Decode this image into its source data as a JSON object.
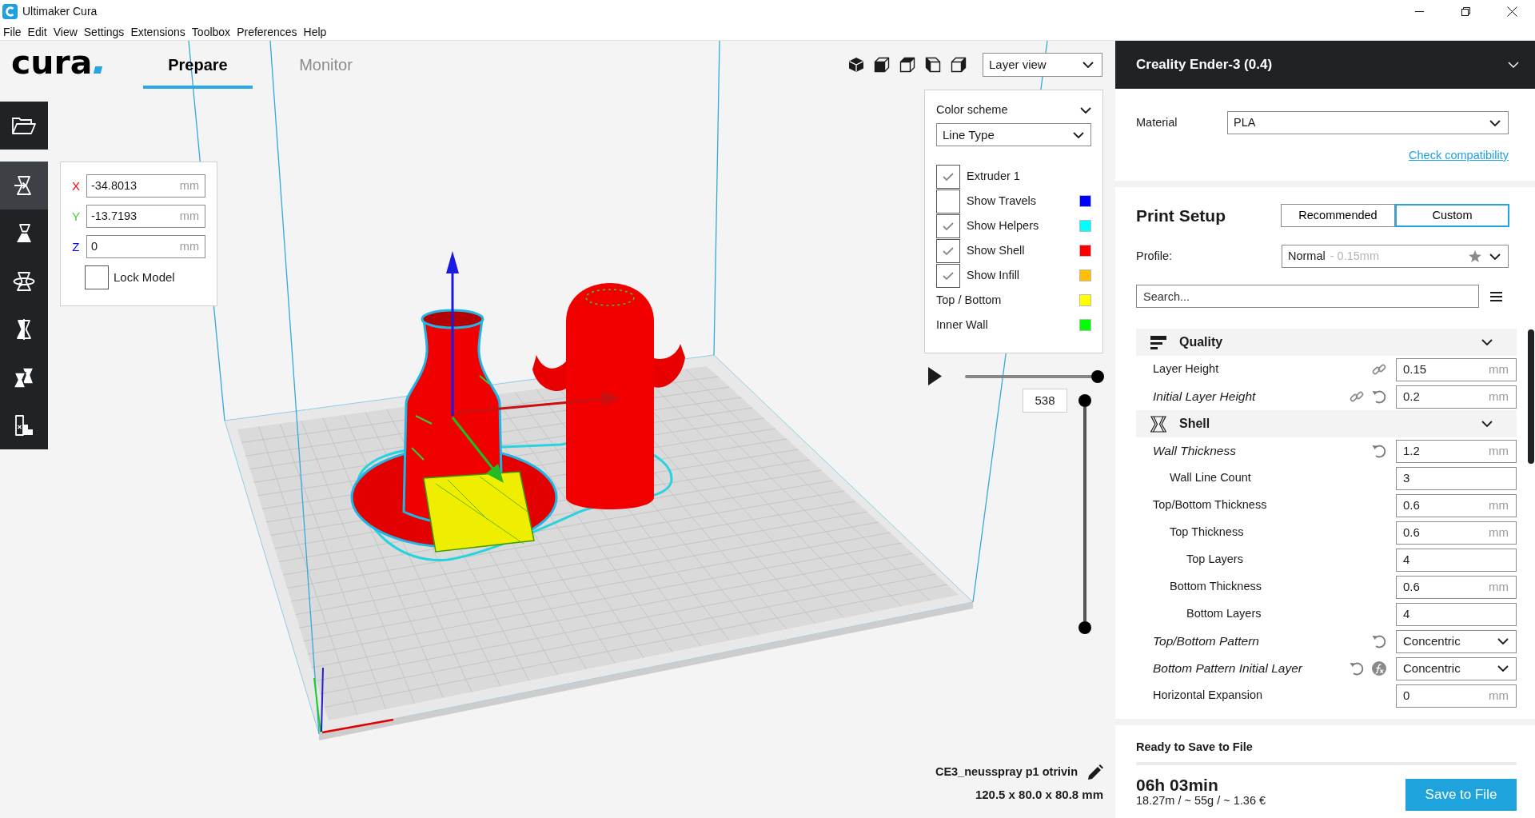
{
  "window": {
    "title": "Ultimaker Cura"
  },
  "menu_bar": [
    {
      "label": "File"
    },
    {
      "label": "Edit"
    },
    {
      "label": "View"
    },
    {
      "label": "Settings"
    },
    {
      "label": "Extensions"
    },
    {
      "label": "Toolbox"
    },
    {
      "label": "Preferences"
    },
    {
      "label": "Help"
    }
  ],
  "header": {
    "logo": "cura",
    "stages": [
      {
        "label": "Prepare",
        "selected": true
      },
      {
        "label": "Monitor",
        "selected": false
      }
    ],
    "view_type": "Layer view"
  },
  "toolbar": {
    "tools": [
      {
        "kind": "move",
        "selected": true
      },
      {
        "kind": "scale",
        "selected": false
      },
      {
        "kind": "rotate",
        "selected": false
      },
      {
        "kind": "mirror",
        "selected": false
      },
      {
        "kind": "per_model_settings",
        "selected": false
      },
      {
        "kind": "support_blocker",
        "selected": false
      }
    ]
  },
  "move_panel": {
    "fields": [
      {
        "axis": "X",
        "color": "#ff0000",
        "value": "-34.8013",
        "unit": "mm"
      },
      {
        "axis": "Y",
        "color": "#40d040",
        "value": "-13.7193",
        "unit": "mm"
      },
      {
        "axis": "Z",
        "color": "#0000ff",
        "value": "0",
        "unit": "mm"
      }
    ],
    "lock_model": {
      "label": "Lock Model",
      "checked": false
    }
  },
  "layer_view": {
    "color_scheme_label": "Color scheme",
    "color_scheme": "Line Type",
    "items": [
      {
        "kind": "checkbox",
        "label": "Extruder 1",
        "checked": true
      },
      {
        "kind": "checkbox",
        "label": "Show Travels",
        "checked": false,
        "color": "#0000ff"
      },
      {
        "kind": "checkbox",
        "label": "Show Helpers",
        "checked": true,
        "color": "#00ffff"
      },
      {
        "kind": "checkbox",
        "label": "Show Shell",
        "checked": true,
        "color": "#ff0000"
      },
      {
        "kind": "checkbox",
        "label": "Show Infill",
        "checked": true,
        "color": "#ffbf00"
      },
      {
        "kind": "legend",
        "label": "Top / Bottom",
        "color": "#ffff00"
      },
      {
        "kind": "legend",
        "label": "Inner Wall",
        "color": "#00ff00"
      }
    ]
  },
  "simulation": {
    "level": 1
  },
  "layer_range": {
    "level": 1,
    "reading": "538"
  },
  "model_info": {
    "name": "CE3_neusspray p1 otrivin",
    "dimensions": "120.5 x 80.0 x 80.8 mm"
  },
  "printer": {
    "name": "Creality Ender-3 (0.4)",
    "material_label": "Material",
    "material": "PLA",
    "compatibility_link": "Check compatibility"
  },
  "print_setup": {
    "title": "Print Setup",
    "modes": [
      {
        "label": "Recommended",
        "selected": false
      },
      {
        "label": "Custom",
        "selected": true
      }
    ],
    "profile_label": "Profile:",
    "profile": "Normal",
    "profile_detail": "- 0.15mm",
    "search": {
      "placeholder": "Search..."
    },
    "categories": [
      {
        "label": "Quality",
        "kind": "quality",
        "expanded": true,
        "settings": [
          {
            "label": "Layer Height",
            "kind": "number",
            "value": "0.15",
            "unit": "mm",
            "overridden": false,
            "linked": true,
            "resettable": false,
            "formula": false
          },
          {
            "label": "Initial Layer Height",
            "kind": "number",
            "value": "0.2",
            "unit": "mm",
            "overridden": true,
            "linked": true,
            "resettable": true,
            "formula": false
          }
        ]
      },
      {
        "label": "Shell",
        "kind": "shell",
        "expanded": true,
        "settings": [
          {
            "label": "Wall Thickness",
            "kind": "number",
            "value": "1.2",
            "unit": "mm",
            "overridden": true,
            "linked": false,
            "resettable": true,
            "formula": false,
            "children": [
              {
                "label": "Wall Line Count",
                "kind": "number",
                "value": "3",
                "overridden": false,
                "linked": false,
                "resettable": false,
                "formula": false
              }
            ]
          },
          {
            "label": "Top/Bottom Thickness",
            "kind": "number",
            "value": "0.6",
            "unit": "mm",
            "overridden": false,
            "linked": false,
            "resettable": false,
            "formula": false,
            "children": [
              {
                "label": "Top Thickness",
                "kind": "number",
                "value": "0.6",
                "unit": "mm",
                "overridden": false,
                "linked": false,
                "resettable": false,
                "formula": false,
                "children": [
                  {
                    "label": "Top Layers",
                    "kind": "number",
                    "value": "4",
                    "overridden": false,
                    "linked": false,
                    "resettable": false,
                    "formula": false
                  }
                ]
              },
              {
                "label": "Bottom Thickness",
                "kind": "number",
                "value": "0.6",
                "unit": "mm",
                "overridden": false,
                "linked": false,
                "resettable": false,
                "formula": false,
                "children": [
                  {
                    "label": "Bottom Layers",
                    "kind": "number",
                    "value": "4",
                    "overridden": false,
                    "linked": false,
                    "resettable": false,
                    "formula": false
                  }
                ]
              }
            ]
          },
          {
            "label": "Top/Bottom Pattern",
            "kind": "dropdown",
            "value": "Concentric",
            "overridden": true,
            "linked": false,
            "resettable": true,
            "formula": false
          },
          {
            "label": "Bottom Pattern Initial Layer",
            "kind": "dropdown",
            "value": "Concentric",
            "overridden": true,
            "linked": false,
            "resettable": true,
            "formula": true
          },
          {
            "label": "Horizontal Expansion",
            "kind": "number",
            "value": "0",
            "unit": "mm",
            "overridden": false,
            "linked": false,
            "resettable": false,
            "formula": false
          }
        ]
      }
    ]
  },
  "output": {
    "status": "Ready to Save to File",
    "time": "06h 03min",
    "estimate": "18.27m / ~ 55g / ~ 1.36 €",
    "button": "Save to File"
  }
}
